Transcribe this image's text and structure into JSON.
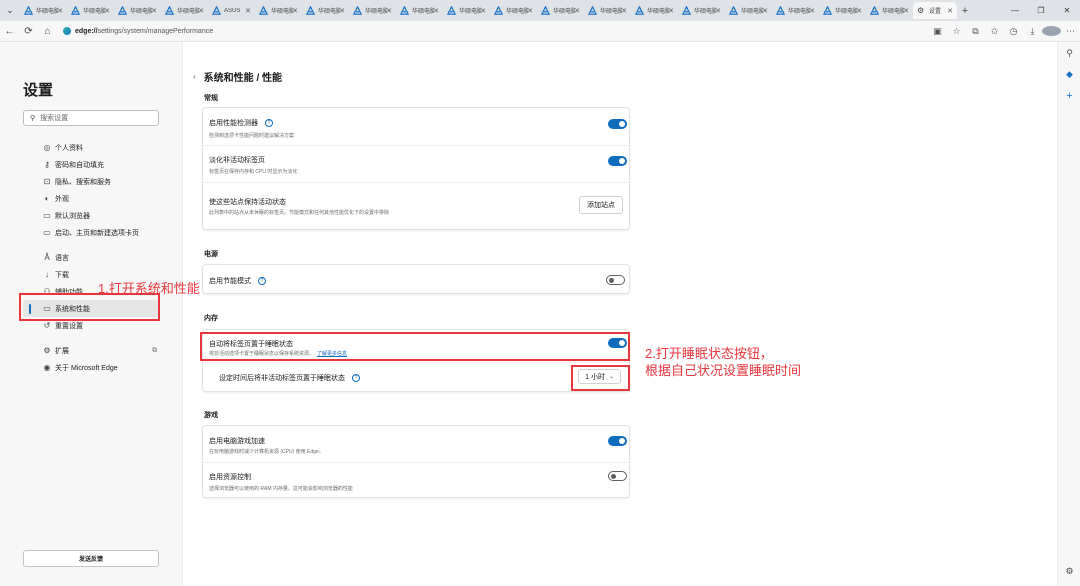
{
  "colors": {
    "accent": "#0f6cbd",
    "annotation": "#e8363d"
  },
  "tabs": [
    {
      "label": "华硕电脑"
    },
    {
      "label": "华硕电脑"
    },
    {
      "label": "华硕电脑"
    },
    {
      "label": "华硕电脑"
    },
    {
      "label": "ASUS"
    },
    {
      "label": "华硕电脑"
    },
    {
      "label": "华硕电脑"
    },
    {
      "label": "华硕电脑"
    },
    {
      "label": "华硕电脑"
    },
    {
      "label": "华硕电脑"
    },
    {
      "label": "华硕电脑"
    },
    {
      "label": "华硕电脑"
    },
    {
      "label": "华硕电脑"
    },
    {
      "label": "华硕电脑"
    },
    {
      "label": "华硕电脑"
    },
    {
      "label": "华硕电脑"
    },
    {
      "label": "华硕电脑"
    },
    {
      "label": "华硕电脑"
    },
    {
      "label": "华硕电脑"
    }
  ],
  "active_tab": {
    "label": "设置"
  },
  "address": {
    "scheme": "edge://",
    "path": "settings/system/managePerformance"
  },
  "sidebar": {
    "title": "设置",
    "search_placeholder": "搜索设置",
    "items": [
      {
        "label": "个人资料",
        "icon": "profile-icon"
      },
      {
        "label": "密码和自动填充",
        "icon": "key-icon"
      },
      {
        "label": "隐私、搜索和服务",
        "icon": "lock-icon"
      },
      {
        "label": "外观",
        "icon": "appearance-icon"
      },
      {
        "label": "默认浏览器",
        "icon": "browser-icon"
      },
      {
        "label": "启动、主页和新建选项卡页",
        "icon": "home-icon"
      },
      {
        "label": "语言",
        "icon": "language-icon"
      },
      {
        "label": "下载",
        "icon": "download-icon"
      },
      {
        "label": "辅助功能",
        "icon": "accessibility-icon"
      },
      {
        "label": "系统和性能",
        "icon": "laptop-icon"
      },
      {
        "label": "重置设置",
        "icon": "reset-icon"
      },
      {
        "label": "扩展",
        "icon": "extension-icon"
      },
      {
        "label": "关于 Microsoft Edge",
        "icon": "edge-icon"
      }
    ],
    "feedback": "发送反馈"
  },
  "page": {
    "title": "系统和性能 / 性能",
    "general": {
      "heading": "常规",
      "perf_detector": {
        "title": "启用性能检测器",
        "desc": "检测到选项卡性能问题时建议解决方案",
        "on": true
      },
      "fade_sleeping": {
        "title": "淡化非活动标签页",
        "desc": "标签页在保存内存和 CPU 时显示为淡化",
        "on": true
      },
      "keep_active": {
        "title": "使这些站点保持活动状态",
        "desc": "此列表中的站点从未休眠的标签页。节能模式和任何其他性能优化下的设置中排除",
        "button": "添加站点"
      }
    },
    "power": {
      "heading": "电源",
      "efficiency": {
        "title": "启用节能模式",
        "on": false
      }
    },
    "memory": {
      "heading": "内存",
      "sleeping_tabs": {
        "title": "自动将标签页置于睡眠状态",
        "desc": "将非活动选项卡置于睡眠状态以保存系统资源。",
        "link": "了解更多信息",
        "on": true
      },
      "sleep_after": {
        "title": "设定时间后将非活动标签页置于睡眠状态",
        "value": "1 小时"
      }
    },
    "gaming": {
      "heading": "游戏",
      "pc_gaming": {
        "title": "启用电脑游戏加速",
        "desc": "在玩电脑游戏时减少计算机资源 (CPU) 使用 Edge。",
        "on": true
      },
      "resource_controls": {
        "title": "启用资源控制",
        "desc": "选择浏览器可以使用的 RAM 内存量。这可能会影响浏览器的性能",
        "on": false
      }
    }
  },
  "annotations": {
    "first": "1.打开系统和性能",
    "second_line1": "2.打开睡眠状态按钮，",
    "second_line2": "根据自己状况设置睡眠时间"
  }
}
